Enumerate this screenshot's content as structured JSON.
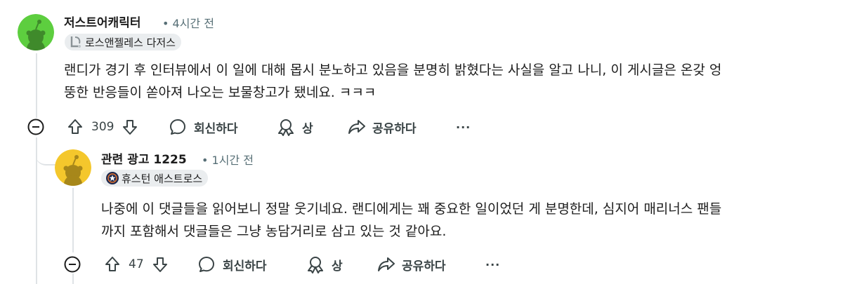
{
  "comments": [
    {
      "username": "저스트어캐릭터",
      "time": "• 4시간 전",
      "flair": "로스앤젤레스 다저스",
      "flair_icon": "dodgers-logo-icon",
      "avatar_color": "#5dce3f",
      "body_lines": [
        "랜디가 경기 후 인터뷰에서 이 일에 대해 몹시 분노하고 있음을 분명히 밝혔다는 사실을 알고 나니, 이 게시글은 온갖 엉",
        "뚱한 반응들이 쏟아져 나오는 보물창고가 됐네요. ㅋㅋㅋ"
      ],
      "votes": "309",
      "reply_label": "회신하다",
      "award_label": "상",
      "share_label": "공유하다",
      "more_label": "···"
    },
    {
      "username": "관련 광고 1225",
      "time": "• 1시간 전",
      "flair": "휴스턴 애스트로스",
      "flair_icon": "astros-logo-icon",
      "avatar_color": "#f4c72c",
      "body_lines": [
        "나중에 이 댓글들을 읽어보니 정말 웃기네요. 랜디에게는 꽤 중요한 일이었던 게 분명한데, 심지어 매리너스 팬들",
        "까지 포함해서 댓글들은 그냥 농담거리로 삼고 있는 것 같아요."
      ],
      "votes": "47",
      "reply_label": "회신하다",
      "award_label": "상",
      "share_label": "공유하다",
      "more_label": "···"
    }
  ]
}
